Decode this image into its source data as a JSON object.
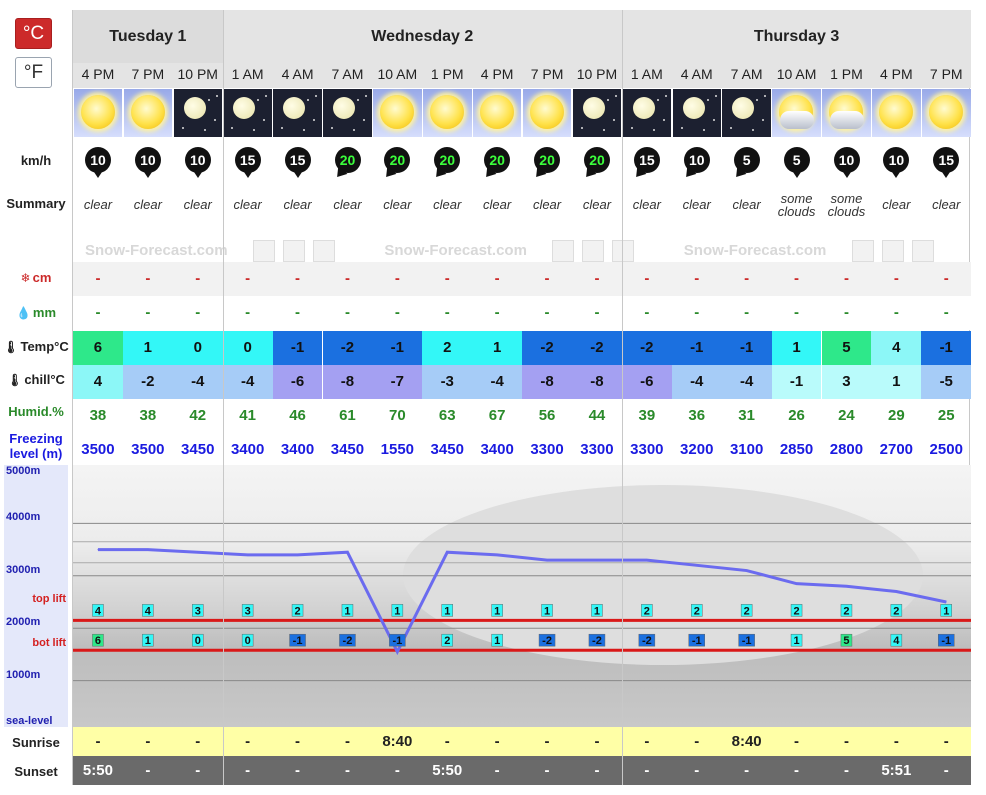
{
  "units": {
    "celsius": "°C",
    "fahrenheit": "°F"
  },
  "row_labels": {
    "wind": "km/h",
    "summary": "Summary",
    "snow": "cm",
    "rain": "mm",
    "temp": "Temp°C",
    "chill": "chill°C",
    "humid": "Humid.%",
    "freezing": "Freezing level (m)",
    "sunrise": "Sunrise",
    "sunset": "Sunset"
  },
  "days": [
    {
      "label": "Tuesday 1",
      "count": 3
    },
    {
      "label": "Wednesday 2",
      "count": 8
    },
    {
      "label": "Thursday 3",
      "count": 7
    }
  ],
  "times": [
    "4 PM",
    "7 PM",
    "10 PM",
    "1 AM",
    "4 AM",
    "7 AM",
    "10 AM",
    "1 PM",
    "4 PM",
    "7 PM",
    "10 PM",
    "1 AM",
    "4 AM",
    "7 AM",
    "10 AM",
    "1 PM",
    "4 PM",
    "7 PM"
  ],
  "weather_icons": [
    "sun-icon",
    "sun-icon",
    "moon-icon",
    "moon-icon",
    "moon-icon",
    "moon-icon",
    "sun-icon",
    "sun-icon",
    "sun-icon",
    "sun-icon",
    "moon-icon",
    "moon-icon",
    "moon-icon",
    "moon-icon",
    "sun-cloud-icon",
    "sun-cloud-icon",
    "sun-icon",
    "sun-icon"
  ],
  "wind": {
    "speeds": [
      "10",
      "10",
      "10",
      "15",
      "15",
      "20",
      "20",
      "20",
      "20",
      "20",
      "20",
      "15",
      "10",
      "5",
      "5",
      "10",
      "10",
      "15"
    ],
    "colors": [
      "white",
      "white",
      "white",
      "white",
      "white",
      "green",
      "green",
      "green",
      "green",
      "green",
      "green",
      "white",
      "white",
      "white",
      "white",
      "white",
      "white",
      "white"
    ],
    "dirs": [
      "down",
      "down",
      "down",
      "down",
      "down",
      "down-left",
      "down-left",
      "down-left",
      "down-left",
      "down-left",
      "down-left",
      "down-left",
      "down-left",
      "down-left",
      "down",
      "down",
      "down",
      "down"
    ]
  },
  "summary": [
    "clear",
    "clear",
    "clear",
    "clear",
    "clear",
    "clear",
    "clear",
    "clear",
    "clear",
    "clear",
    "clear",
    "clear",
    "clear",
    "clear",
    "some clouds",
    "some clouds",
    "clear",
    "clear"
  ],
  "watermark": "Snow-Forecast.com",
  "snow": [
    "-",
    "-",
    "-",
    "-",
    "-",
    "-",
    "-",
    "-",
    "-",
    "-",
    "-",
    "-",
    "-",
    "-",
    "-",
    "-",
    "-",
    "-"
  ],
  "rain": [
    "-",
    "-",
    "-",
    "-",
    "-",
    "-",
    "-",
    "-",
    "-",
    "-",
    "-",
    "-",
    "-",
    "-",
    "-",
    "-",
    "-",
    "-"
  ],
  "temp": [
    "6",
    "1",
    "0",
    "0",
    "-1",
    "-2",
    "-1",
    "2",
    "1",
    "-2",
    "-2",
    "-2",
    "-1",
    "-1",
    "1",
    "5",
    "4",
    "-1"
  ],
  "chill": [
    "4",
    "-2",
    "-4",
    "-4",
    "-6",
    "-8",
    "-7",
    "-3",
    "-4",
    "-8",
    "-8",
    "-6",
    "-4",
    "-4",
    "-1",
    "3",
    "1",
    "-5"
  ],
  "humid": [
    "38",
    "38",
    "42",
    "41",
    "46",
    "61",
    "70",
    "63",
    "67",
    "56",
    "44",
    "39",
    "36",
    "31",
    "26",
    "24",
    "29",
    "25"
  ],
  "freezing": [
    "3500",
    "3500",
    "3450",
    "3400",
    "3400",
    "3450",
    "1550",
    "3450",
    "3400",
    "3300",
    "3300",
    "3300",
    "3200",
    "3100",
    "2850",
    "2800",
    "2700",
    "2500"
  ],
  "chart_axis": [
    "5000m",
    "4000m",
    "3000m",
    "2000m",
    "1000m",
    "sea-level"
  ],
  "lift_labels": {
    "top": "top lift",
    "bottom": "bot lift"
  },
  "top_lift_temps": [
    "4",
    "4",
    "3",
    "3",
    "2",
    "1",
    "1",
    "1",
    "1",
    "1",
    "1",
    "2",
    "2",
    "2",
    "2",
    "2",
    "2",
    "1"
  ],
  "bot_lift_temps": [
    "6",
    "1",
    "0",
    "0",
    "-1",
    "-2",
    "-1",
    "2",
    "1",
    "-2",
    "-2",
    "-2",
    "-1",
    "-1",
    "1",
    "5",
    "4",
    "-1"
  ],
  "sunrise": [
    "-",
    "-",
    "-",
    "-",
    "-",
    "-",
    "8:40",
    "-",
    "-",
    "-",
    "-",
    "-",
    "-",
    "8:40",
    "-",
    "-",
    "-",
    "-"
  ],
  "sunset": [
    "5:50",
    "-",
    "-",
    "-",
    "-",
    "-",
    "-",
    "5:50",
    "-",
    "-",
    "-",
    "-",
    "-",
    "-",
    "-",
    "-",
    "5:51",
    "-"
  ],
  "colors": {
    "temp_6": "#2ee88a",
    "temp_5": "#2ee88a",
    "temp_4": "#8cf7f7",
    "temp_2": "#33f7f7",
    "temp_1": "#33f7f7",
    "temp_0": "#33f7f7",
    "temp_m1": "#1b70e0",
    "temp_m2": "#1b70e0",
    "chill_4": "#8cf7f7",
    "chill_3": "#b9fbfb",
    "chill_1": "#b9fbfb",
    "chill_m1": "#b9fbfb",
    "chill_m2": "#a6ccf7",
    "chill_m3": "#a6ccf7",
    "chill_m4": "#a6ccf7",
    "chill_m5": "#a6ccf7",
    "chill_m6": "#a4a0f2",
    "chill_m7": "#a4a0f2",
    "chill_m8": "#a4a0f2",
    "freezing_line": "#6b6bef",
    "lift_line": "#d91818"
  }
}
